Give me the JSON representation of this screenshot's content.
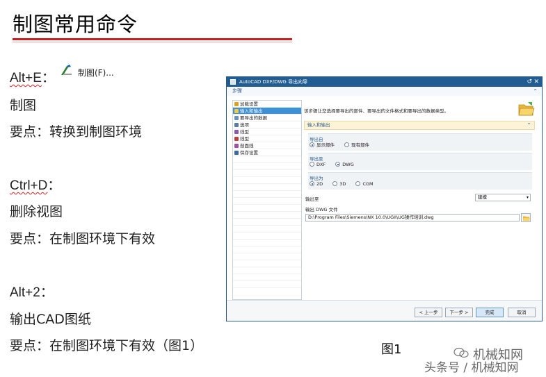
{
  "slide": {
    "title": "制图常用命令",
    "items": [
      {
        "shortcut": "Alt+E",
        "suffix": "：",
        "menu_label": "制图(F)...",
        "name": "制图",
        "note": "要点：转换到制图环境"
      },
      {
        "shortcut": "Ctrl+D",
        "suffix": "：",
        "name": "删除视图",
        "note": "要点：在制图环境下有效"
      },
      {
        "shortcut": "Alt+2",
        "suffix": "：",
        "name": "输出CAD图纸",
        "note": "要点：在制图环境下有效（图1）"
      }
    ],
    "figure_label": "图1",
    "watermark": {
      "line1": "机械知网",
      "line2": "头条号 / 机械知网"
    }
  },
  "dialog": {
    "title": "AutoCAD DXF/DWG 导出向导",
    "steps_label": "步骤",
    "steps": [
      "加载设置",
      "输入和输出",
      "要导出的数据",
      "选项",
      "线型",
      "线型",
      "剖面线",
      "保存设置"
    ],
    "selected_step": 1,
    "description": "该步骤让您选择要导出的部件、要导出的文件格式和要导出的数据类型。",
    "section_title": "输入和输出",
    "groups": [
      {
        "title": "导出自",
        "options": [
          "显示部件",
          "现有部件"
        ],
        "selected": 0
      },
      {
        "title": "导出至",
        "options": [
          "DXF",
          "DWG"
        ],
        "selected": 1
      },
      {
        "title": "导出为",
        "options": [
          "2D",
          "3D",
          "CGM"
        ],
        "selected": 0
      }
    ],
    "output_to_label": "输出至",
    "output_to_value": "建模",
    "dwg_file_label": "输出 DWG 文件",
    "dwg_file_path": "D:\\Program Files\\Siemens\\NX 10.0\\UGII\\UG操作培训.dwg",
    "buttons": {
      "back": "< 上一步",
      "next": "下一步 >",
      "finish": "完成",
      "cancel": "取消"
    }
  },
  "colors": {
    "title_rule": "#c81e1e",
    "dialog_titlebar": "#1f5d92",
    "selected_step": "#3d8fd6",
    "section_header": "#fdf3d6"
  }
}
